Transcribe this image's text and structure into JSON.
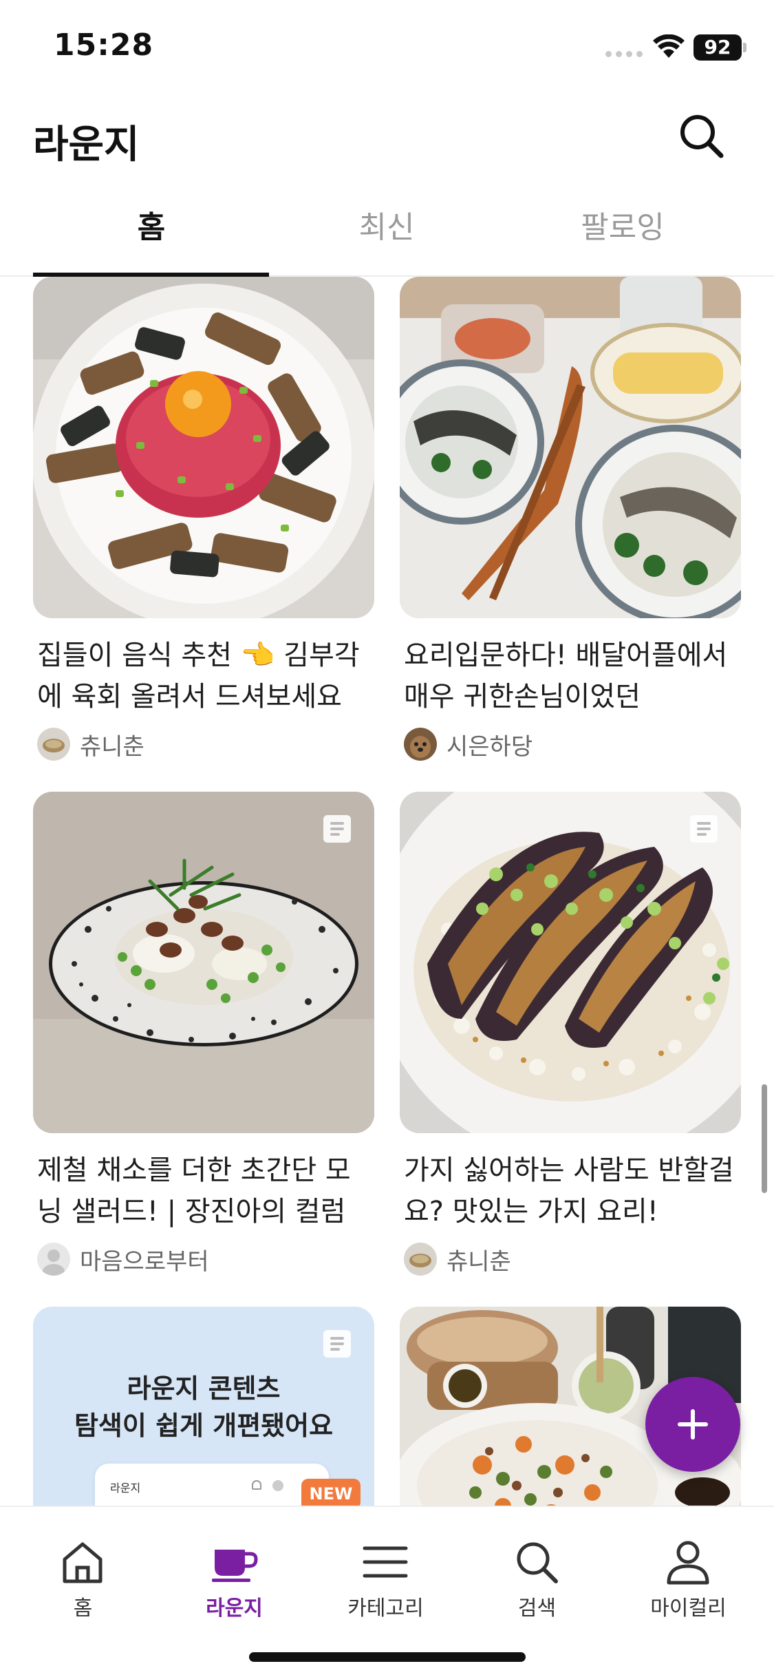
{
  "status_bar": {
    "time": "15:28",
    "battery": "92"
  },
  "header": {
    "title": "라운지"
  },
  "tabs": [
    {
      "label": "홈",
      "active": true
    },
    {
      "label": "최신",
      "active": false
    },
    {
      "label": "팔로잉",
      "active": false
    }
  ],
  "cards": [
    {
      "title": "집들이 음식 추천 👈 김부각에 육회 올려서 드셔보세요",
      "author": "츄니춘"
    },
    {
      "title": "요리입문하다!  배달어플에서 매우 귀한손님이었던",
      "author": "시은하당"
    },
    {
      "title": "제철 채소를 더한 초간단 모닝 샐러드! | 장진아의 컬럼",
      "author": "마음으로부터"
    },
    {
      "title": "가지 싫어하는 사람도 반할걸요? 맛있는 가지 요리!",
      "author": "츄니춘"
    },
    {
      "promo_line1": "라운지 콘텐츠",
      "promo_line2": "탐색이 쉽게 개편됐어요",
      "mock_title": "라운지",
      "new_badge": "NEW"
    }
  ],
  "bottom_nav": [
    {
      "label": "홈",
      "icon": "home-icon",
      "active": false
    },
    {
      "label": "라운지",
      "icon": "coffee-cup-icon",
      "active": true
    },
    {
      "label": "카테고리",
      "icon": "menu-icon",
      "active": false
    },
    {
      "label": "검색",
      "icon": "search-icon",
      "active": false
    },
    {
      "label": "마이컬리",
      "icon": "person-icon",
      "active": false
    }
  ],
  "colors": {
    "accent": "#7a1fa2",
    "text": "#1d1d1d",
    "muted": "#9a9a9a"
  }
}
